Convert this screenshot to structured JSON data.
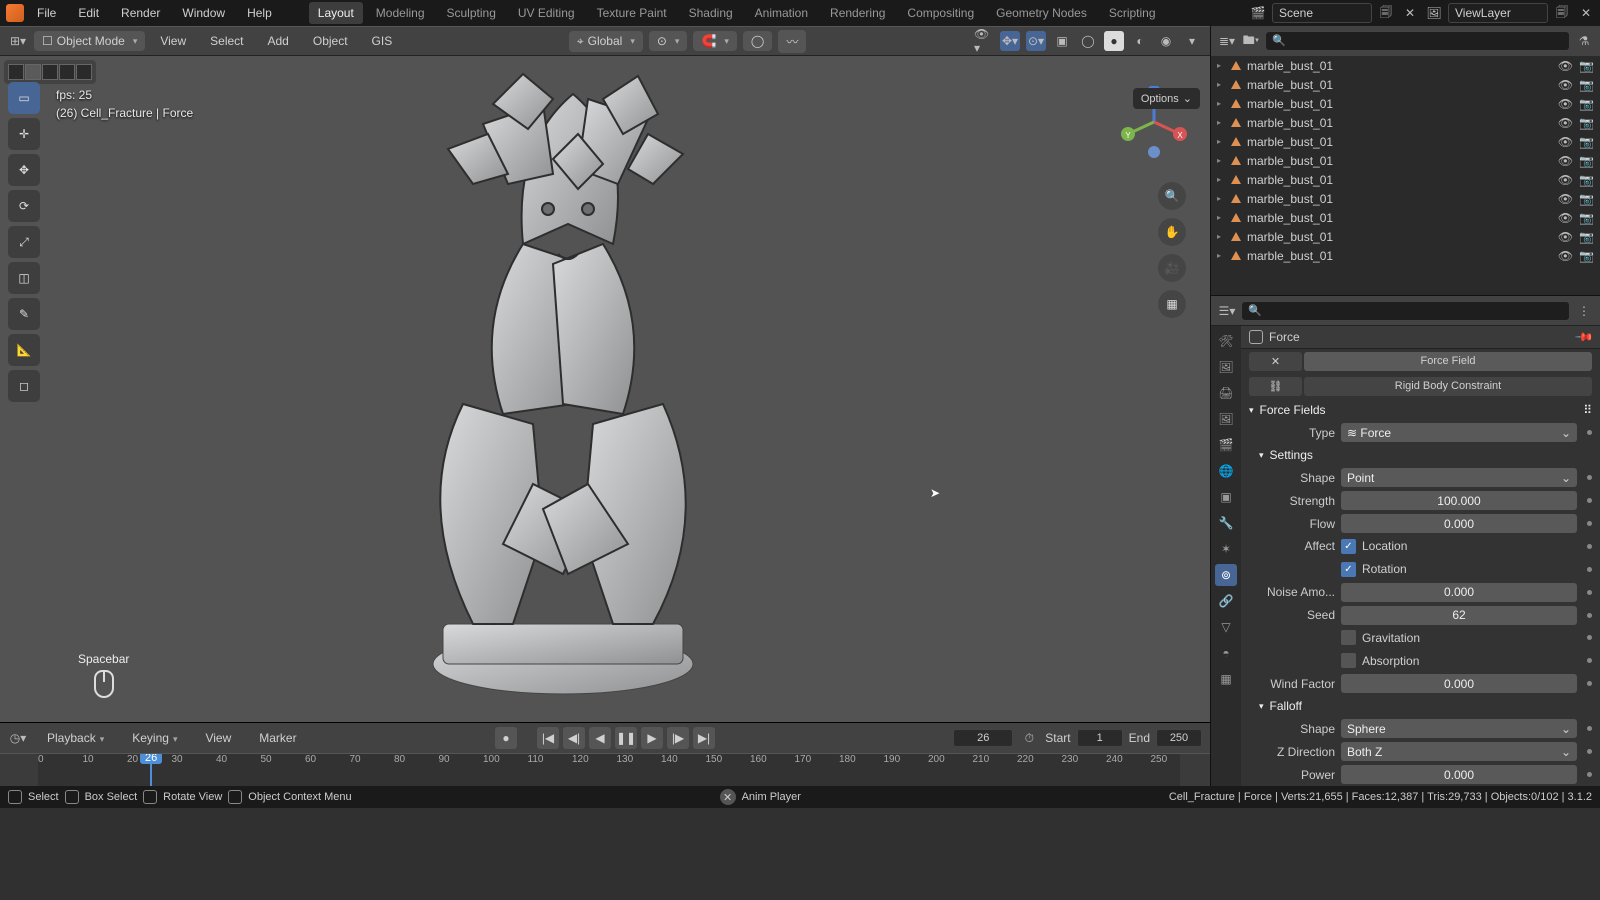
{
  "top_menus": [
    "File",
    "Edit",
    "Render",
    "Window",
    "Help"
  ],
  "workspace_tabs": [
    "Layout",
    "Modeling",
    "Sculpting",
    "UV Editing",
    "Texture Paint",
    "Shading",
    "Animation",
    "Rendering",
    "Compositing",
    "Geometry Nodes",
    "Scripting"
  ],
  "active_tab": "Layout",
  "scene": {
    "scene_name": "Scene",
    "view_layer": "ViewLayer"
  },
  "toolbar": {
    "mode": "Object Mode",
    "menus": [
      "View",
      "Select",
      "Add",
      "Object",
      "GIS"
    ],
    "orientation": "Global"
  },
  "viewport": {
    "options_label": "Options",
    "fps_label": "fps: 25",
    "context_label": "(26) Cell_Fracture | Force",
    "key_hint": "Spacebar"
  },
  "outliner": {
    "items": [
      "marble_bust_01",
      "marble_bust_01",
      "marble_bust_01",
      "marble_bust_01",
      "marble_bust_01",
      "marble_bust_01",
      "marble_bust_01",
      "marble_bust_01",
      "marble_bust_01",
      "marble_bust_01",
      "marble_bust_01"
    ]
  },
  "properties": {
    "object_name": "Force",
    "tabs": {
      "force_field": "Force Field",
      "rigid_body_constraint": "Rigid Body Constraint"
    },
    "panel_title": "Force Fields",
    "type_label": "Type",
    "type_value": "Force",
    "settings_label": "Settings",
    "shape_label": "Shape",
    "shape_value": "Point",
    "strength_label": "Strength",
    "strength_value": "100.000",
    "flow_label": "Flow",
    "flow_value": "0.000",
    "affect_label": "Affect",
    "affect_loc": "Location",
    "affect_rot": "Rotation",
    "noise_label": "Noise Amo...",
    "noise_value": "0.000",
    "seed_label": "Seed",
    "seed_value": "62",
    "grav_label": "Gravitation",
    "abs_label": "Absorption",
    "wind_label": "Wind Factor",
    "wind_value": "0.000",
    "falloff_label": "Falloff",
    "f_shape_label": "Shape",
    "f_shape_value": "Sphere",
    "zdir_label": "Z Direction",
    "zdir_value": "Both Z",
    "power_label": "Power",
    "power_value": "0.000"
  },
  "timeline": {
    "menus": [
      "Playback",
      "Keying",
      "View",
      "Marker"
    ],
    "current": "26",
    "start_label": "Start",
    "start": "1",
    "end_label": "End",
    "end": "250",
    "ticks": [
      "0",
      "10",
      "20",
      "30",
      "40",
      "50",
      "60",
      "70",
      "80",
      "90",
      "100",
      "110",
      "120",
      "130",
      "140",
      "150",
      "160",
      "170",
      "180",
      "190",
      "200",
      "210",
      "220",
      "230",
      "240",
      "250"
    ]
  },
  "status": {
    "left": [
      {
        "k": "Select"
      },
      {
        "k": "Box Select"
      },
      {
        "k": "Rotate View"
      },
      {
        "k": "Object Context Menu"
      }
    ],
    "anim_player": "Anim Player",
    "right": "Cell_Fracture | Force | Verts:21,655 | Faces:12,387 | Tris:29,733 | Objects:0/102 | 3.1.2"
  }
}
